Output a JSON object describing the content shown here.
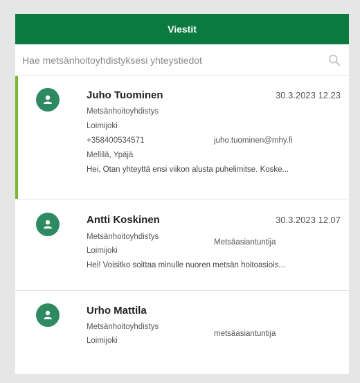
{
  "header": {
    "title": "Viestit"
  },
  "search": {
    "placeholder": "Hae metsänhoitoyhdistyksesi yhteystiedot"
  },
  "colors": {
    "brand": "#0a7a3f",
    "accent": "#7ab830",
    "avatar": "#2e8a60"
  },
  "icons": {
    "search": "search-icon",
    "avatar": "user-icon"
  },
  "contacts": [
    {
      "name": "Juho Tuominen",
      "time": "30.3.2023 12.23",
      "org": "Metsänhoitoyhdistys",
      "org_sub": "Loimijoki",
      "phone": "+358400534571",
      "email": "juho.tuominen@mhy.fi",
      "location": "Mellilä, Ypäjä",
      "preview": "Hei, Otan yhteyttä ensi viikon alusta puhelimitse. Koske..."
    },
    {
      "name": "Antti Koskinen",
      "time": "30.3.2023 12.07",
      "org": "Metsänhoitoyhdistys",
      "org_sub": "Loimijoki",
      "role": "Metsäasiantuntija",
      "preview": "Hei! Voisitko soittaa minulle nuoren metsän hoitoasiois..."
    },
    {
      "name": "Urho Mattila",
      "org": "Metsänhoitoyhdistys",
      "org_sub": "Loimijoki",
      "role": "metsäasiantuntija"
    }
  ]
}
